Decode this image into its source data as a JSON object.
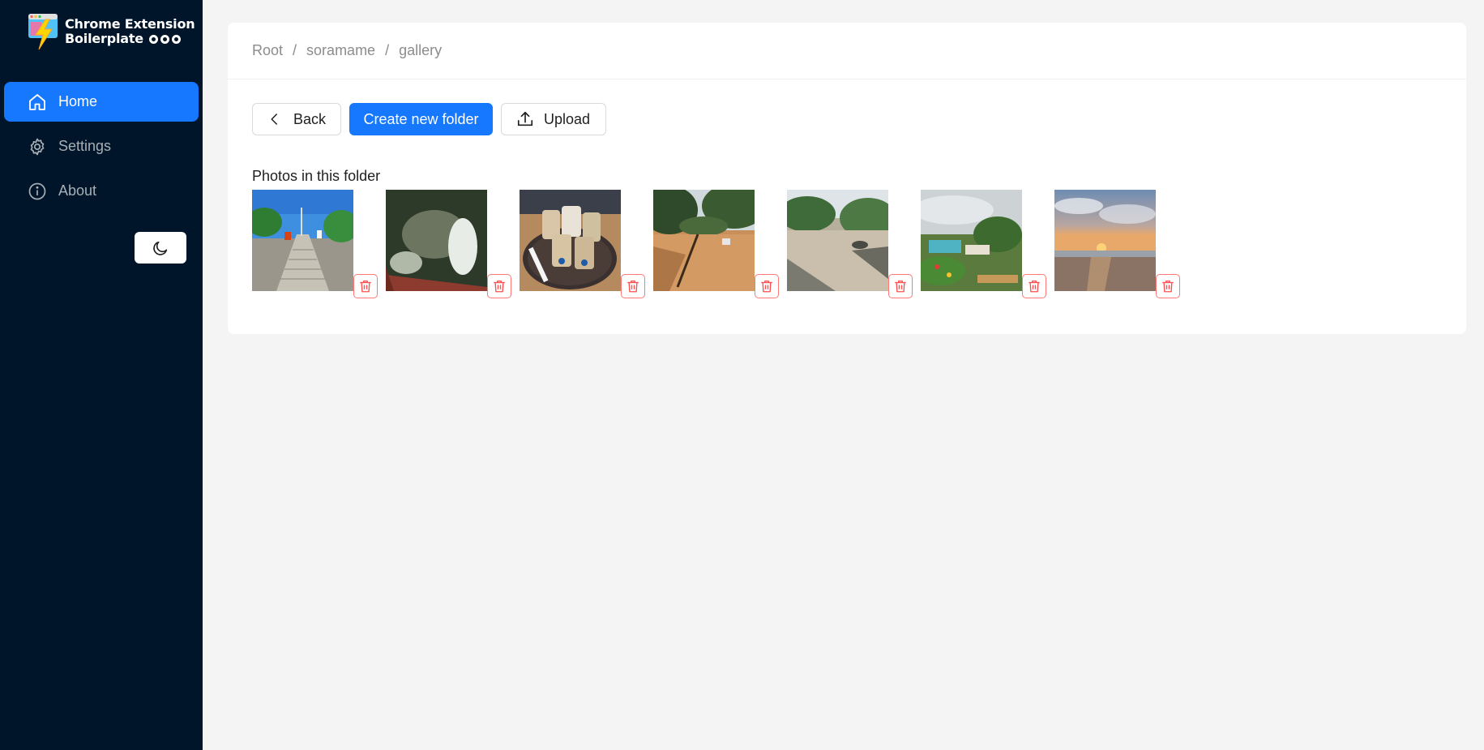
{
  "brand": {
    "line1": "Chrome Extension",
    "line2": "Boilerplate",
    "icon": "bolt-window-logo"
  },
  "sidebar": {
    "items": [
      {
        "label": "Home",
        "icon": "home-icon",
        "active": true
      },
      {
        "label": "Settings",
        "icon": "gear-icon",
        "active": false
      },
      {
        "label": "About",
        "icon": "info-icon",
        "active": false
      }
    ],
    "theme_toggle_icon": "moon-icon"
  },
  "breadcrumb": {
    "items": [
      "Root",
      "soramame",
      "gallery"
    ],
    "separator": "/"
  },
  "toolbar": {
    "back_label": "Back",
    "create_label": "Create new folder",
    "upload_label": "Upload"
  },
  "gallery": {
    "title": "Photos in this folder",
    "photos": [
      {
        "subject": "stone-stairway-trees-blue-sky"
      },
      {
        "subject": "pond-water-reflection"
      },
      {
        "subject": "iced-drinks-on-tray"
      },
      {
        "subject": "sandy-path-trees"
      },
      {
        "subject": "rocky-beach-shrubs"
      },
      {
        "subject": "village-greenery-cloudy-sky"
      },
      {
        "subject": "beach-sunset"
      }
    ]
  },
  "colors": {
    "sidebar_bg": "#001529",
    "accent": "#1677ff",
    "danger": "#ff4d4f",
    "page_bg": "#f4f4f4"
  }
}
